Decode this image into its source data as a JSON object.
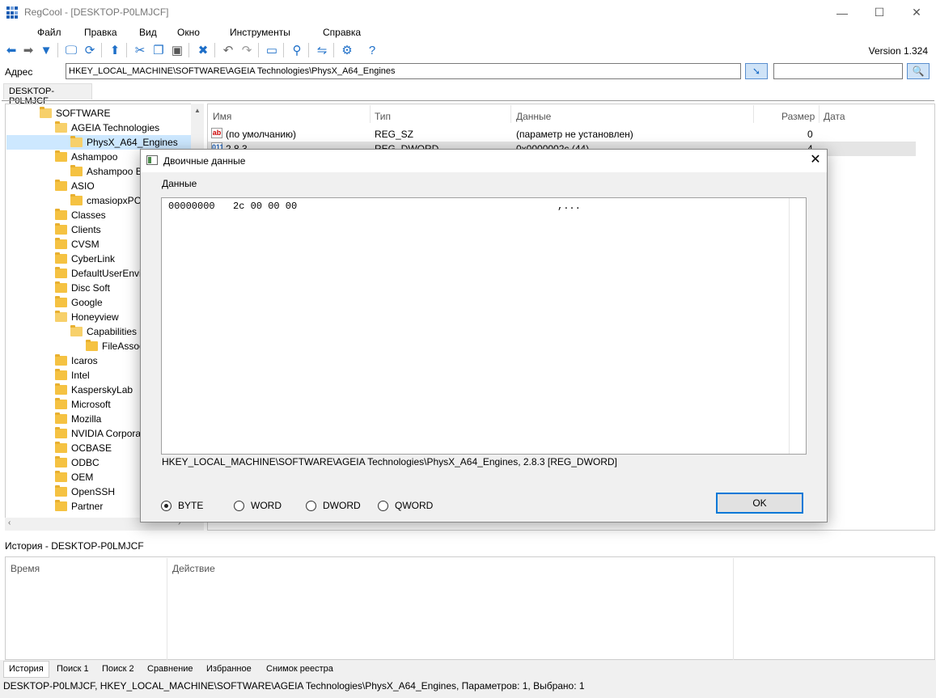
{
  "window": {
    "title": "RegCool - [DESKTOP-P0LMJCF]",
    "minimize": "—",
    "maximize": "☐",
    "close": "✕"
  },
  "menu": {
    "items": [
      "Файл",
      "Правка",
      "Вид",
      "Окно",
      "Инструменты",
      "Справка"
    ]
  },
  "toolbar": {
    "version": "Version 1.324"
  },
  "address": {
    "label": "Адрес",
    "value": "HKEY_LOCAL_MACHINE\\SOFTWARE\\AGEIA Technologies\\PhysX_A64_Engines",
    "search_value": ""
  },
  "computer_tab": "DESKTOP-P0LMJCF",
  "tree": {
    "items": [
      "SOFTWARE",
      "AGEIA Technologies",
      "PhysX_A64_Engines",
      "Ashampoo",
      "Ashampoo B",
      "ASIO",
      "cmasiopxPC",
      "Classes",
      "Clients",
      "CVSM",
      "CyberLink",
      "DefaultUserEnvi",
      "Disc Soft",
      "Google",
      "Honeyview",
      "Capabilities",
      "FileAssoc",
      "Icaros",
      "Intel",
      "KasperskyLab",
      "Microsoft",
      "Mozilla",
      "NVIDIA Corpora",
      "OCBASE",
      "ODBC",
      "OEM",
      "OpenSSH",
      "Partner"
    ]
  },
  "list": {
    "columns": [
      "Имя",
      "Тип",
      "Данные",
      "Размер",
      "Дата"
    ],
    "rows": [
      {
        "icon": "ab",
        "name": "(по умолчанию)",
        "type": "REG_SZ",
        "data": "(параметр не установлен)",
        "size": "0"
      },
      {
        "icon": "011",
        "name": "2.8.3",
        "type": "REG_DWORD",
        "data": "0x0000002c (44)",
        "size": "4"
      }
    ]
  },
  "dialog": {
    "title": "Двоичные данные",
    "data_label": "Данные",
    "hex_offset": "00000000",
    "hex_bytes": "2c 00 00 00",
    "hex_ascii": ",...",
    "value_path": "HKEY_LOCAL_MACHINE\\SOFTWARE\\AGEIA Technologies\\PhysX_A64_Engines, 2.8.3 [REG_DWORD]",
    "radios": [
      "BYTE",
      "WORD",
      "DWORD",
      "QWORD"
    ],
    "selected_radio": "BYTE",
    "ok_label": "OK",
    "close": "✕"
  },
  "history": {
    "title": "История - DESKTOP-P0LMJCF",
    "columns": [
      "Время",
      "Действие"
    ]
  },
  "bottom_tabs": [
    "История",
    "Поиск 1",
    "Поиск 2",
    "Сравнение",
    "Избранное",
    "Снимок реестра"
  ],
  "status": "DESKTOP-P0LMJCF, HKEY_LOCAL_MACHINE\\SOFTWARE\\AGEIA Technologies\\PhysX_A64_Engines, Параметров: 1, Выбрано: 1",
  "colors": {
    "accent": "#0078d7",
    "selection": "#cde8ff",
    "folder": "#f5c242"
  }
}
